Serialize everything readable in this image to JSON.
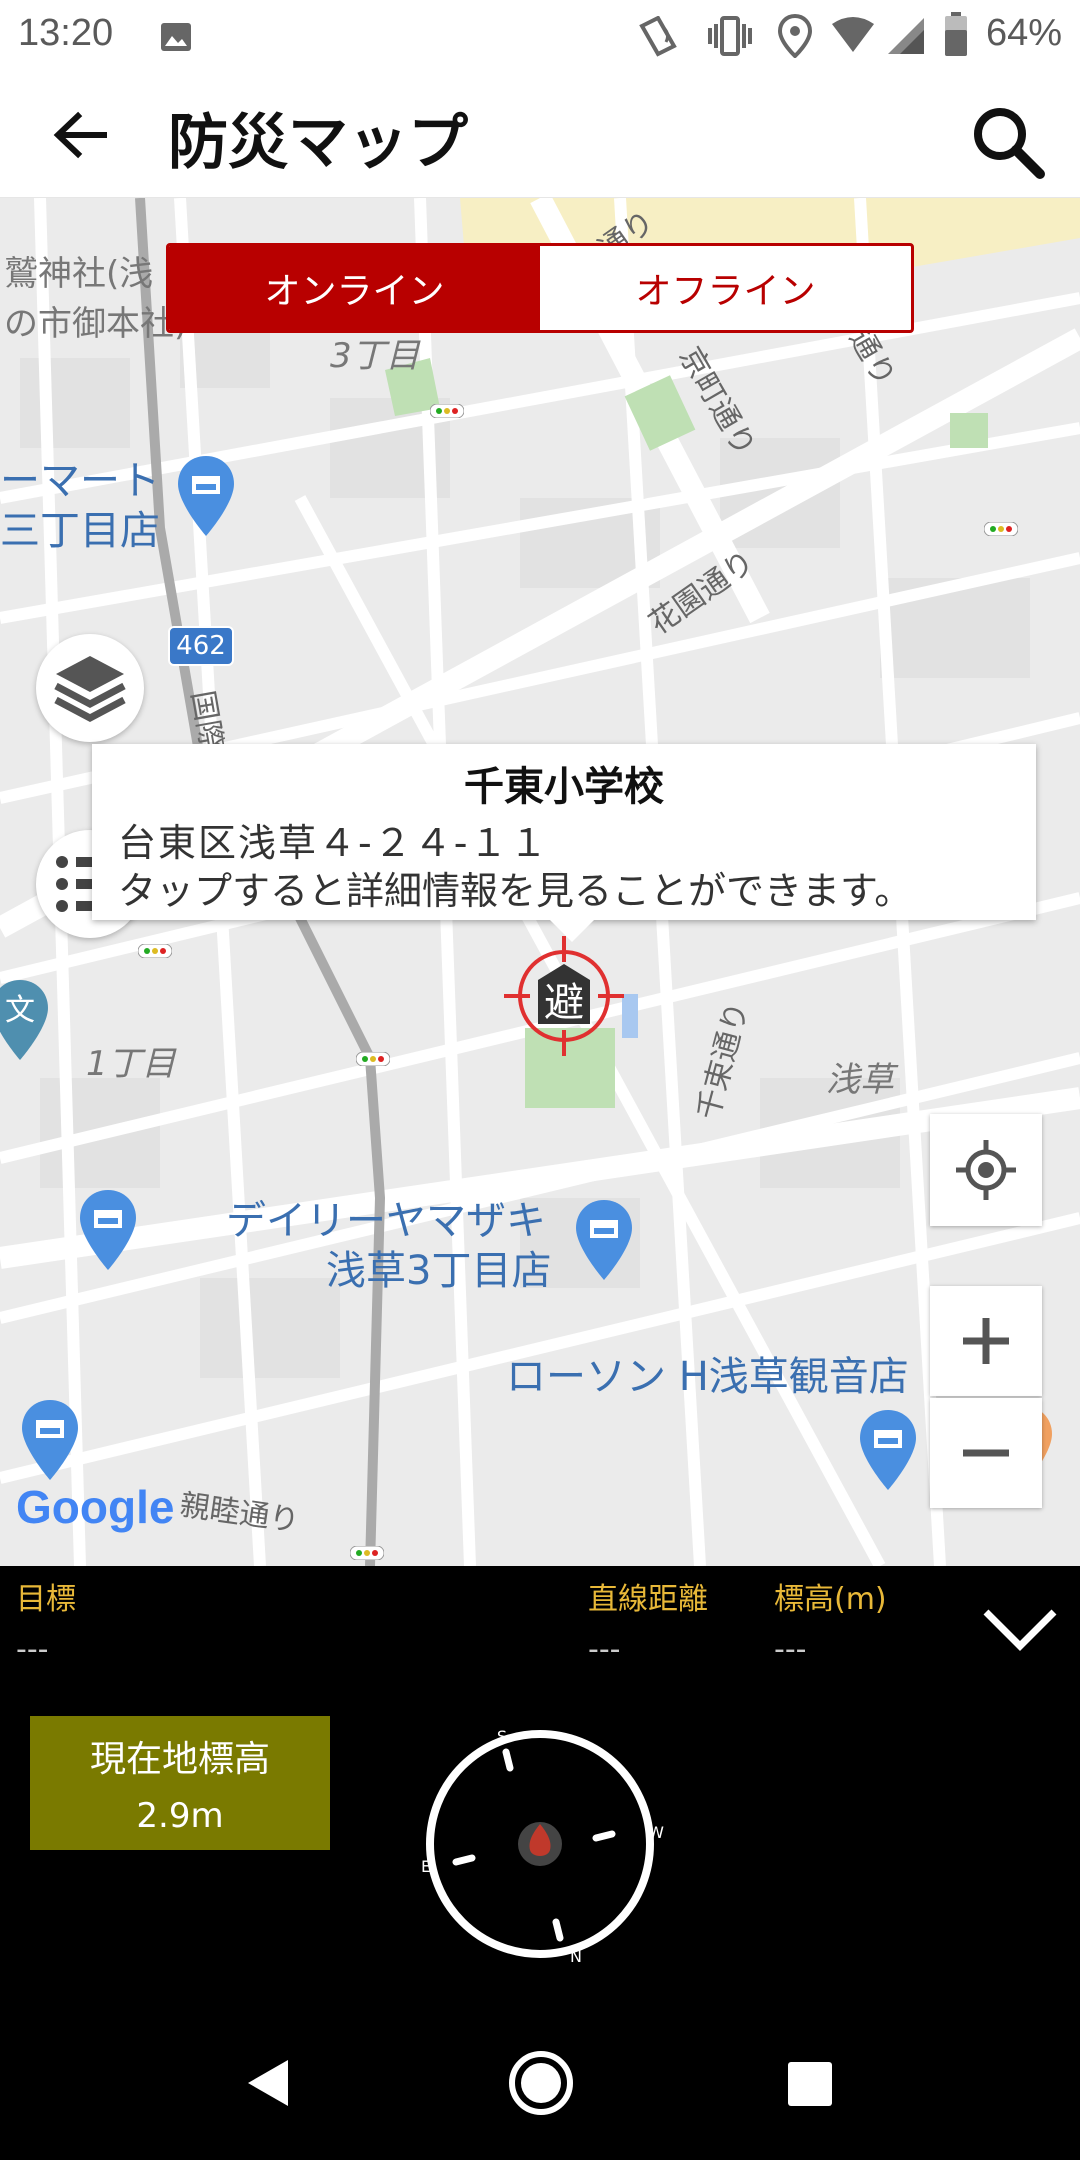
{
  "status_bar": {
    "time": "13:20",
    "battery": "64%"
  },
  "app_bar": {
    "title": "防災マップ",
    "back_icon": "arrow-left-icon",
    "search_icon": "search-icon"
  },
  "mode_toggle": {
    "online": "オンライン",
    "offline": "オフライン",
    "selected": "online"
  },
  "map": {
    "labels": {
      "shrine": "鷲神社(浅",
      "shrine2": "の市御本社)",
      "chome3": "3丁目",
      "kyomachi": "京町通り",
      "kado": "角町通り",
      "shimachi": "之町通り",
      "hanazono": "花園通り",
      "family1": "ーマート",
      "family2": "三丁目店",
      "route": "462",
      "kokusai": "国際",
      "chome1": "1丁目",
      "senzoku_st": "千束通り",
      "asakusa": "浅草",
      "daily1": "デイリーヤマザキ",
      "daily2": "浅草3丁目店",
      "lawson": "ローソン H浅草観音店",
      "shinboku": "親睦通り",
      "google": "Google"
    },
    "marker_glyph": "避",
    "info_window": {
      "name": "千東小学校",
      "address": "台東区浅草４-２４-１１",
      "hint": "タップすると詳細情報を見ることができます。"
    }
  },
  "panel": {
    "target_label": "目標",
    "target_value": "---",
    "distance_label": "直線距離",
    "distance_value": "---",
    "elevation_label": "標高(m)",
    "elevation_value": "---",
    "current_elev_title": "現在地標高",
    "current_elev_value": "2.9m",
    "compass": {
      "n": "N",
      "s": "S",
      "e": "E",
      "w": "W"
    }
  },
  "colors": {
    "accent": "#b80000",
    "panel_label": "#e8b838",
    "elev_box": "#7a7a00"
  }
}
